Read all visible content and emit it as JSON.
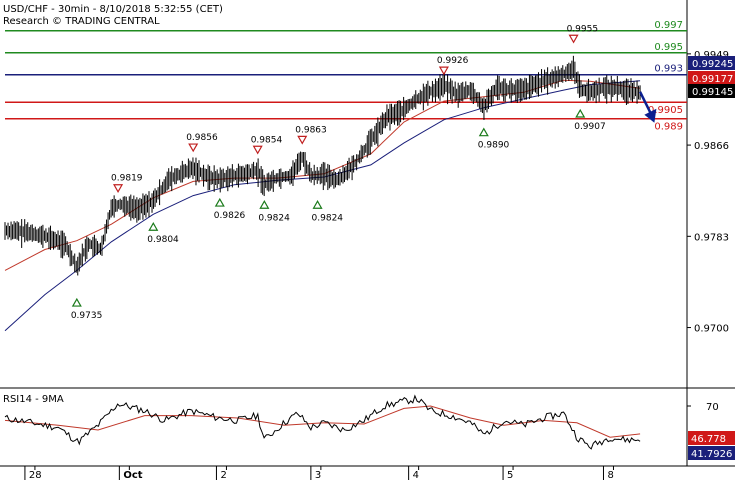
{
  "header": {
    "title": "USD/CHF - 30min - 8/10/2018 5:32:55 (CET)",
    "subtitle": "Research © TRADING CENTRAL"
  },
  "colors": {
    "background": "#ffffff",
    "axis": "#000000",
    "resistance_green": "#1f8a1f",
    "pivot_navy": "#1a1f7a",
    "support_red": "#d01818",
    "ma_fast": "#c0392b",
    "ma_slow": "#1a1f7a",
    "candle": "#000000",
    "arrow": "#0b1f8f",
    "up_marker": "#1a7a1a",
    "down_marker": "#c02020"
  },
  "chart_data": [
    {
      "type": "line",
      "name": "price",
      "ylim": [
        0.9645,
        0.9998
      ],
      "x_ticks": [
        "28",
        "Oct",
        "2",
        "3",
        "4",
        "5",
        "8"
      ],
      "y_ticks": [
        "0.9949",
        "0.9866",
        "0.9783",
        "0.9700"
      ],
      "horizontal_levels": [
        {
          "label": "0.997",
          "value": 0.997,
          "color": "#1f8a1f"
        },
        {
          "label": "0.995",
          "value": 0.995,
          "color": "#1f8a1f"
        },
        {
          "label": "0.993",
          "value": 0.993,
          "color": "#1a1f7a"
        },
        {
          "label": "0.9905",
          "value": 0.9905,
          "color": "#d01818"
        },
        {
          "label": "0.989",
          "value": 0.989,
          "color": "#d01818"
        }
      ],
      "price_tags": [
        {
          "label": "0.99245",
          "value": 0.99245,
          "color": "#1a1f7a"
        },
        {
          "label": "0.99177",
          "value": 0.99177,
          "color": "#d01818"
        },
        {
          "label": "0.99145",
          "value": 0.99145,
          "color": "#000000"
        }
      ],
      "markers": [
        {
          "kind": "low",
          "label": "0.9735",
          "t": 0.108,
          "value": 0.9735
        },
        {
          "kind": "high",
          "label": "0.9819",
          "t": 0.17,
          "value": 0.9819
        },
        {
          "kind": "low",
          "label": "0.9804",
          "t": 0.223,
          "value": 0.9804
        },
        {
          "kind": "high",
          "label": "0.9856",
          "t": 0.283,
          "value": 0.9856
        },
        {
          "kind": "low",
          "label": "0.9826",
          "t": 0.323,
          "value": 0.9826
        },
        {
          "kind": "high",
          "label": "0.9854",
          "t": 0.38,
          "value": 0.9854
        },
        {
          "kind": "low",
          "label": "0.9824",
          "t": 0.39,
          "value": 0.9824
        },
        {
          "kind": "high",
          "label": "0.9863",
          "t": 0.447,
          "value": 0.9863
        },
        {
          "kind": "low",
          "label": "0.9824",
          "t": 0.47,
          "value": 0.9824
        },
        {
          "kind": "high",
          "label": "0.9926",
          "t": 0.66,
          "value": 0.9926
        },
        {
          "kind": "low",
          "label": "0.9890",
          "t": 0.72,
          "value": 0.989
        },
        {
          "kind": "high",
          "label": "0.9955",
          "t": 0.855,
          "value": 0.9955
        },
        {
          "kind": "low",
          "label": "0.9907",
          "t": 0.865,
          "value": 0.9907
        }
      ],
      "price_path": [
        [
          0.0,
          0.9788
        ],
        [
          0.03,
          0.9787
        ],
        [
          0.06,
          0.9783
        ],
        [
          0.09,
          0.9776
        ],
        [
          0.108,
          0.9755
        ],
        [
          0.125,
          0.9776
        ],
        [
          0.145,
          0.9771
        ],
        [
          0.16,
          0.981
        ],
        [
          0.175,
          0.9812
        ],
        [
          0.2,
          0.9808
        ],
        [
          0.223,
          0.9815
        ],
        [
          0.245,
          0.9834
        ],
        [
          0.265,
          0.984
        ],
        [
          0.283,
          0.9845
        ],
        [
          0.305,
          0.9837
        ],
        [
          0.323,
          0.9835
        ],
        [
          0.345,
          0.9838
        ],
        [
          0.365,
          0.984
        ],
        [
          0.38,
          0.9843
        ],
        [
          0.39,
          0.983
        ],
        [
          0.41,
          0.9836
        ],
        [
          0.43,
          0.9838
        ],
        [
          0.447,
          0.9855
        ],
        [
          0.46,
          0.9838
        ],
        [
          0.48,
          0.9839
        ],
        [
          0.5,
          0.9834
        ],
        [
          0.525,
          0.9848
        ],
        [
          0.55,
          0.987
        ],
        [
          0.575,
          0.9892
        ],
        [
          0.6,
          0.9898
        ],
        [
          0.625,
          0.991
        ],
        [
          0.645,
          0.9916
        ],
        [
          0.66,
          0.9921
        ],
        [
          0.68,
          0.9912
        ],
        [
          0.7,
          0.9916
        ],
        [
          0.72,
          0.99
        ],
        [
          0.74,
          0.9919
        ],
        [
          0.76,
          0.9916
        ],
        [
          0.78,
          0.9916
        ],
        [
          0.8,
          0.9922
        ],
        [
          0.82,
          0.9926
        ],
        [
          0.84,
          0.993
        ],
        [
          0.855,
          0.9936
        ],
        [
          0.865,
          0.9917
        ],
        [
          0.88,
          0.9914
        ],
        [
          0.9,
          0.9918
        ],
        [
          0.92,
          0.9918
        ],
        [
          0.94,
          0.9915
        ],
        [
          0.955,
          0.99145
        ]
      ],
      "ma_fast_path": [
        [
          0.0,
          0.9752
        ],
        [
          0.06,
          0.9771
        ],
        [
          0.108,
          0.9779
        ],
        [
          0.16,
          0.9794
        ],
        [
          0.223,
          0.9818
        ],
        [
          0.283,
          0.9833
        ],
        [
          0.345,
          0.9836
        ],
        [
          0.41,
          0.9836
        ],
        [
          0.48,
          0.984
        ],
        [
          0.55,
          0.9858
        ],
        [
          0.6,
          0.9887
        ],
        [
          0.66,
          0.9906
        ],
        [
          0.72,
          0.991
        ],
        [
          0.78,
          0.9914
        ],
        [
          0.84,
          0.9925
        ],
        [
          0.88,
          0.9924
        ],
        [
          0.955,
          0.99177
        ]
      ],
      "ma_slow_path": [
        [
          0.0,
          0.9697
        ],
        [
          0.06,
          0.973
        ],
        [
          0.108,
          0.9752
        ],
        [
          0.16,
          0.9778
        ],
        [
          0.223,
          0.9803
        ],
        [
          0.283,
          0.982
        ],
        [
          0.345,
          0.983
        ],
        [
          0.41,
          0.9834
        ],
        [
          0.48,
          0.9837
        ],
        [
          0.55,
          0.9848
        ],
        [
          0.6,
          0.9868
        ],
        [
          0.66,
          0.9889
        ],
        [
          0.72,
          0.99
        ],
        [
          0.78,
          0.9908
        ],
        [
          0.84,
          0.9916
        ],
        [
          0.88,
          0.9921
        ],
        [
          0.955,
          0.99245
        ]
      ],
      "forecast_arrow": [
        [
          0.955,
          0.99145
        ],
        [
          0.975,
          0.989
        ]
      ]
    },
    {
      "type": "line",
      "name": "RSI14 - 9MA",
      "title": "RSI14 - 9MA",
      "ylim": [
        20,
        85
      ],
      "y_ticks": [
        "70"
      ],
      "price_tags": [
        {
          "label": "46.778",
          "value": 46.778,
          "color": "#d01818"
        },
        {
          "label": "41.7926",
          "value": 41.7926,
          "color": "#1a1f7a"
        }
      ],
      "rsi_path": [
        [
          0.0,
          60
        ],
        [
          0.04,
          56
        ],
        [
          0.08,
          52
        ],
        [
          0.11,
          40
        ],
        [
          0.14,
          54
        ],
        [
          0.17,
          72
        ],
        [
          0.21,
          66
        ],
        [
          0.24,
          58
        ],
        [
          0.28,
          66
        ],
        [
          0.32,
          60
        ],
        [
          0.35,
          58
        ],
        [
          0.38,
          62
        ],
        [
          0.39,
          42
        ],
        [
          0.42,
          56
        ],
        [
          0.44,
          64
        ],
        [
          0.46,
          52
        ],
        [
          0.48,
          56
        ],
        [
          0.51,
          50
        ],
        [
          0.54,
          58
        ],
        [
          0.57,
          70
        ],
        [
          0.6,
          74
        ],
        [
          0.62,
          76
        ],
        [
          0.64,
          66
        ],
        [
          0.67,
          62
        ],
        [
          0.7,
          56
        ],
        [
          0.72,
          46
        ],
        [
          0.75,
          58
        ],
        [
          0.78,
          54
        ],
        [
          0.81,
          60
        ],
        [
          0.84,
          64
        ],
        [
          0.86,
          44
        ],
        [
          0.88,
          36
        ],
        [
          0.91,
          44
        ],
        [
          0.93,
          42
        ],
        [
          0.955,
          41.79
        ]
      ],
      "rsi_ma_path": [
        [
          0.0,
          58
        ],
        [
          0.08,
          54
        ],
        [
          0.14,
          50
        ],
        [
          0.21,
          62
        ],
        [
          0.28,
          62
        ],
        [
          0.35,
          60
        ],
        [
          0.42,
          54
        ],
        [
          0.48,
          56
        ],
        [
          0.54,
          55
        ],
        [
          0.6,
          68
        ],
        [
          0.64,
          70
        ],
        [
          0.7,
          60
        ],
        [
          0.75,
          54
        ],
        [
          0.81,
          58
        ],
        [
          0.86,
          56
        ],
        [
          0.91,
          44
        ],
        [
          0.955,
          46.78
        ]
      ]
    }
  ]
}
